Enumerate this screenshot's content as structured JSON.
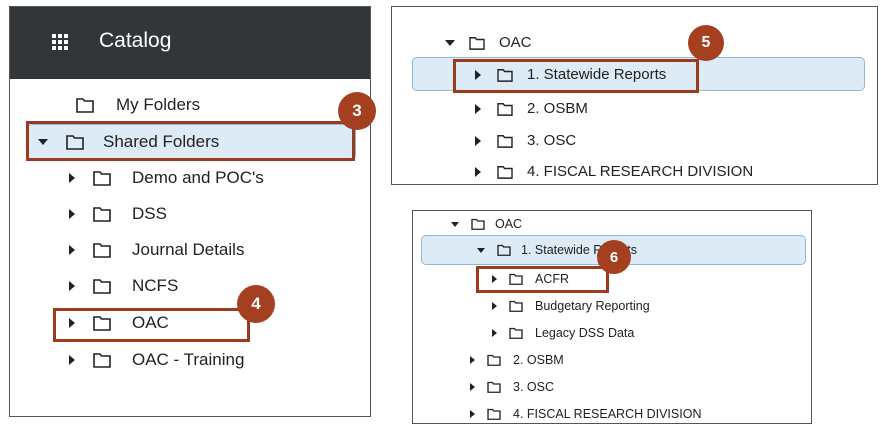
{
  "catalog_panel": {
    "title": "Catalog",
    "items": [
      {
        "label": "My Folders",
        "expander": "none"
      },
      {
        "label": "Shared Folders",
        "expander": "expanded"
      },
      {
        "label": "Demo and POC's",
        "expander": "collapsed"
      },
      {
        "label": "DSS",
        "expander": "collapsed"
      },
      {
        "label": "Journal Details",
        "expander": "collapsed"
      },
      {
        "label": "NCFS",
        "expander": "collapsed"
      },
      {
        "label": "OAC",
        "expander": "collapsed"
      },
      {
        "label": "OAC - Training",
        "expander": "collapsed"
      }
    ],
    "step_badges": [
      "3",
      "4"
    ]
  },
  "oac_panel": {
    "items": [
      {
        "label": "OAC",
        "expander": "expanded"
      },
      {
        "label": "1. Statewide Reports",
        "expander": "collapsed"
      },
      {
        "label": "2. OSBM",
        "expander": "collapsed"
      },
      {
        "label": "3. OSC",
        "expander": "collapsed"
      },
      {
        "label": "4. FISCAL RESEARCH DIVISION",
        "expander": "collapsed"
      }
    ],
    "step_badge": "5"
  },
  "statewide_panel": {
    "items": [
      {
        "label": "OAC",
        "expander": "expanded"
      },
      {
        "label": "1. Statewide Reports",
        "expander": "expanded"
      },
      {
        "label": "ACFR",
        "expander": "collapsed"
      },
      {
        "label": "Budgetary Reporting",
        "expander": "collapsed"
      },
      {
        "label": "Legacy DSS Data",
        "expander": "collapsed"
      },
      {
        "label": "2. OSBM",
        "expander": "collapsed"
      },
      {
        "label": "3. OSC",
        "expander": "collapsed"
      },
      {
        "label": "4. FISCAL RESEARCH DIVISION",
        "expander": "collapsed"
      }
    ],
    "step_badge": "6"
  },
  "colors": {
    "header_bg": "#333638",
    "highlight_bg": "#dcebf6",
    "callout": "#9b3b1d",
    "badge": "#a4401f"
  }
}
